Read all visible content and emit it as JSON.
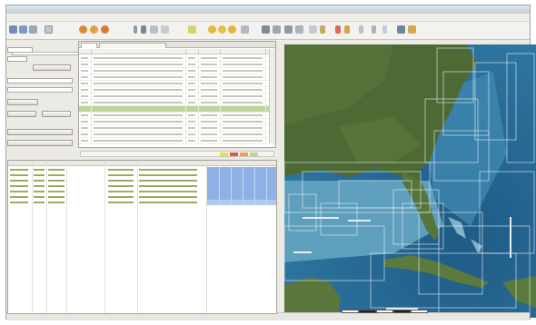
{
  "window": {
    "title": ""
  },
  "menu": {
    "items": []
  },
  "colors": {
    "selected_row": "#bcd59a",
    "grid_highlight": "#8fb2e6",
    "map_ocean": "#2b6c95",
    "map_land": "#4d6a34",
    "chart_outline": "#e8f1f6"
  },
  "toolbar": {
    "icons": [
      "open-icon",
      "save-icon",
      "print-icon",
      "select-icon",
      "layers-icon",
      "identify-icon",
      "text-tool-icon",
      "pencil-icon",
      "zoom-in-icon",
      "zoom-out-icon",
      "pan-icon",
      "globe-icon",
      "measure-icon",
      "info-icon",
      "arrow-up-icon",
      "export-icon"
    ]
  },
  "left_panel": {
    "labels": [],
    "buttons": []
  },
  "list_panel": {
    "tabs": [],
    "columns": [],
    "rows": [],
    "selected_row_index": 8
  },
  "legend_bar": {
    "text": "",
    "swatch_colors": [
      "#e8e04a",
      "#e05a4a",
      "#e8a04a",
      "#b7d98c"
    ]
  },
  "grid": {
    "columns": [],
    "rows": []
  },
  "map": {
    "labels": [],
    "scale_segments": 5
  },
  "status": {
    "text": ""
  }
}
